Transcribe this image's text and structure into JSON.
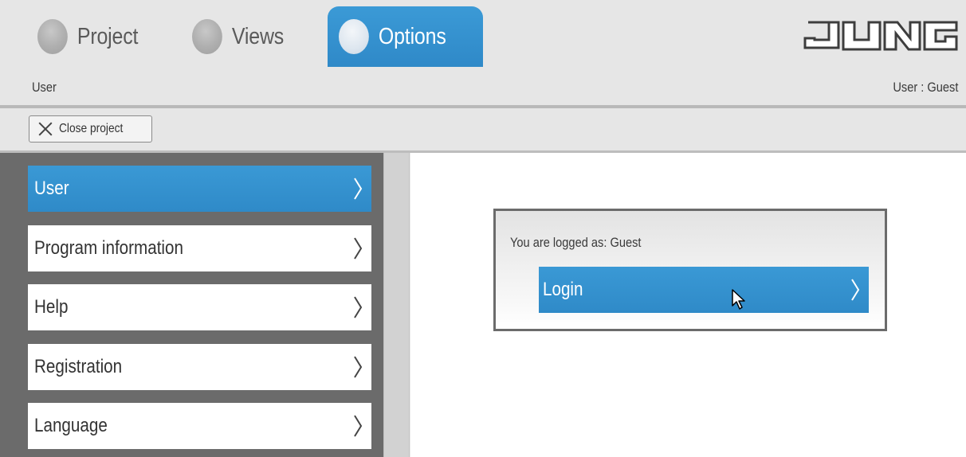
{
  "tabs": [
    {
      "label": "Project",
      "active": false
    },
    {
      "label": "Views",
      "active": false
    },
    {
      "label": "Options",
      "active": true
    }
  ],
  "logo_text": "JUNG",
  "breadcrumb": "User",
  "user_status": "User : Guest",
  "toolbar": {
    "close_label": "Close project",
    "close_icon": "close-x-icon"
  },
  "sidebar": {
    "items": [
      {
        "label": "User",
        "active": true
      },
      {
        "label": "Program information",
        "active": false
      },
      {
        "label": "Help",
        "active": false
      },
      {
        "label": "Registration",
        "active": false
      },
      {
        "label": "Language",
        "active": false
      }
    ]
  },
  "login_panel": {
    "status_text": "You are logged as: Guest",
    "login_label": "Login"
  },
  "colors": {
    "accent": "#3a99d5",
    "sidebar_bg": "#6b6b6b",
    "page_bg": "#e6e6e6"
  }
}
